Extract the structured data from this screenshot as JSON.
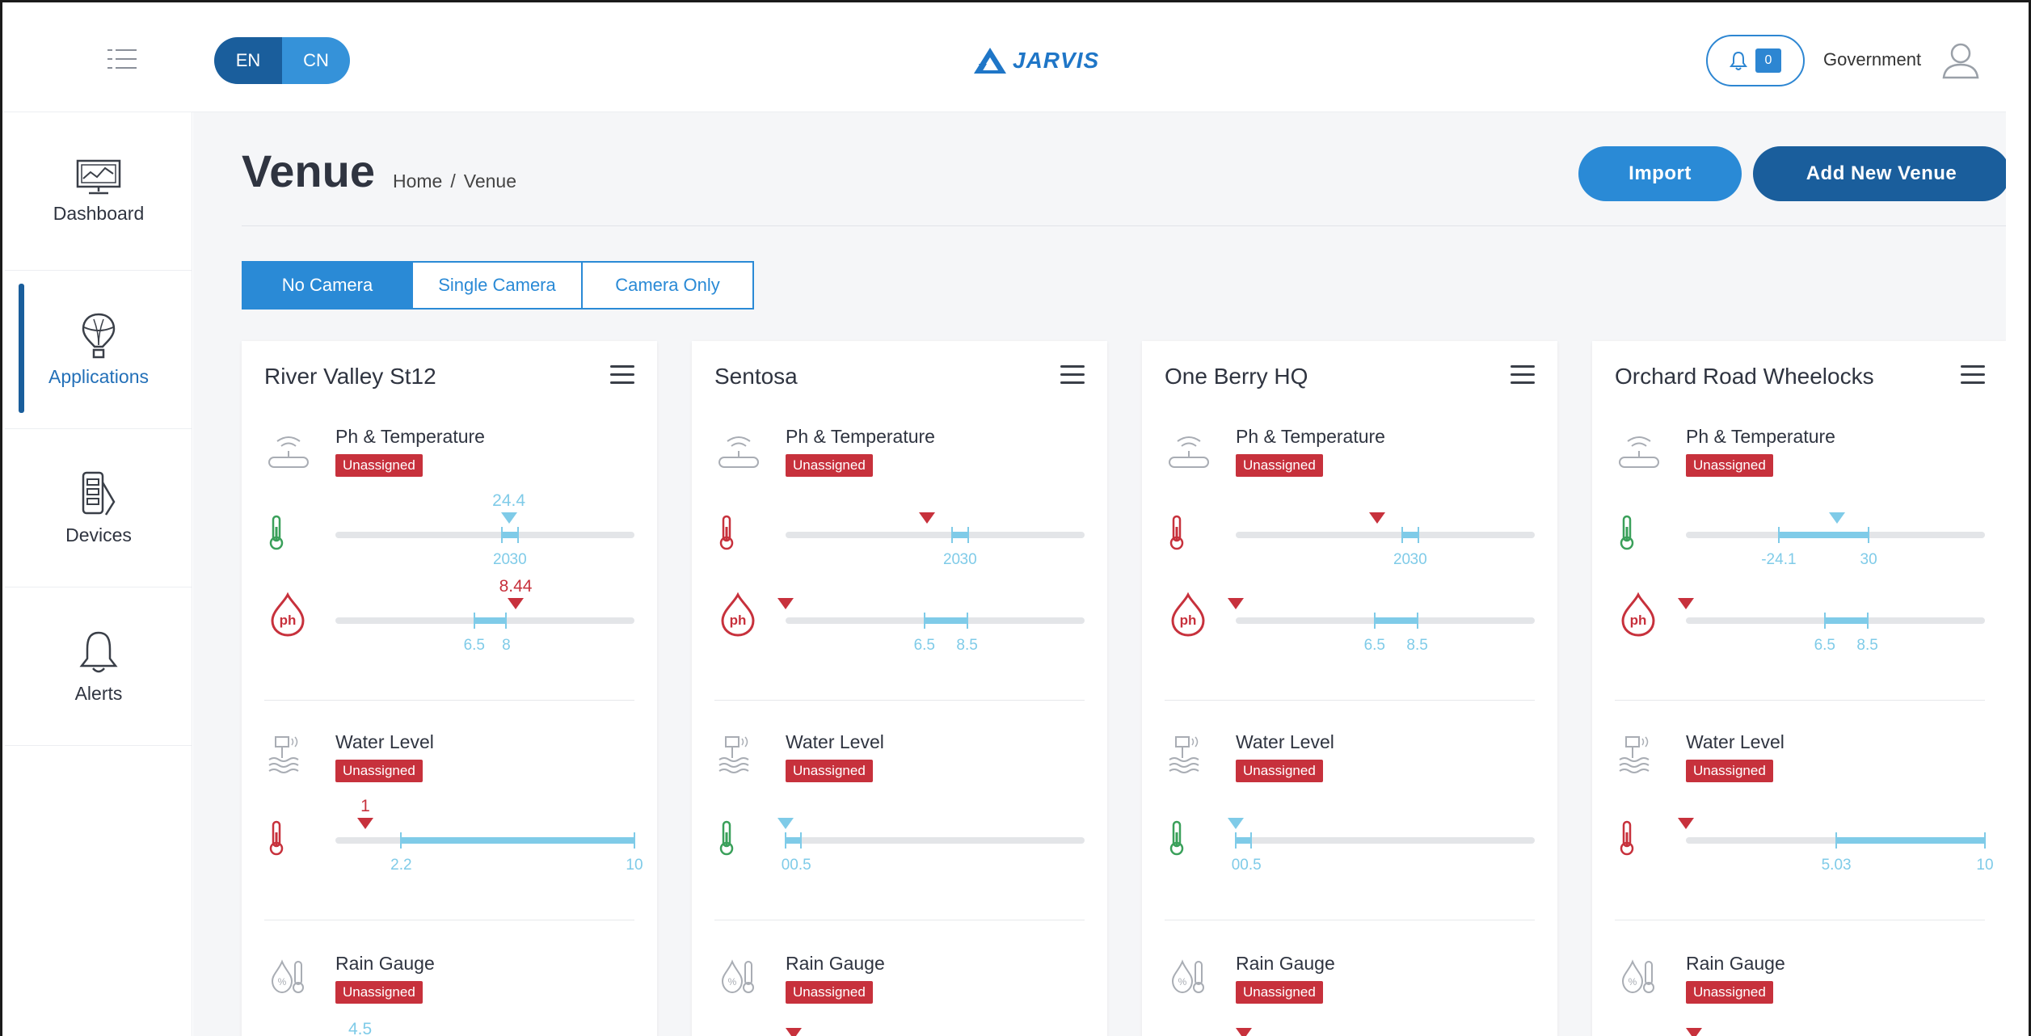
{
  "header": {
    "lang_en": "EN",
    "lang_cn": "CN",
    "logo_text": "JARVIS",
    "notification_count": "0",
    "user_name": "Government"
  },
  "sidebar": {
    "items": [
      {
        "label": "Dashboard",
        "icon": "dashboard-monitor-icon"
      },
      {
        "label": "Applications",
        "icon": "balloon-icon"
      },
      {
        "label": "Devices",
        "icon": "devices-icon"
      },
      {
        "label": "Alerts",
        "icon": "bell-icon"
      }
    ]
  },
  "page": {
    "title": "Venue",
    "breadcrumb": [
      "Home",
      "/",
      "Venue"
    ],
    "import_label": "Import",
    "add_label": "Add New Venue",
    "tabs": [
      "No Camera",
      "Single Camera",
      "Camera Only"
    ]
  },
  "colors": {
    "primary_dark": "#1a5e9c",
    "primary": "#2a8ad6",
    "alert_red": "#c7313c",
    "range_blue": "#7fcbe8"
  },
  "cards": [
    {
      "title": "River Valley St12",
      "ph_temp_name": "Ph & Temperature",
      "ph_temp_badge": "Unassigned",
      "temp": {
        "value": "24.4",
        "min_label": "20",
        "max_label": "30",
        "marker_color": "blue",
        "thermo_color": "green",
        "min": 20,
        "max": 30,
        "reading": 24.4,
        "scale_min": -80,
        "scale_max": 100
      },
      "ph": {
        "value": "8.44",
        "min_label": "6.5",
        "max_label": "8",
        "marker_color": "red",
        "min": 6.5,
        "max": 8,
        "reading": 8.44
      },
      "water_name": "Water Level",
      "water_badge": "Unassigned",
      "water": {
        "value": "1",
        "min_label": "2.2",
        "max_label": "10",
        "marker_color": "red",
        "thermo_color": "red",
        "min": 2.2,
        "max": 10,
        "reading": 1
      },
      "rain_name": "Rain Gauge",
      "rain_badge": "Unassigned",
      "rain_value": "4.5"
    },
    {
      "title": "Sentosa",
      "ph_temp_name": "Ph & Temperature",
      "ph_temp_badge": "Unassigned",
      "temp": {
        "value": "",
        "min_label": "20",
        "max_label": "30",
        "marker_color": "red",
        "thermo_color": "red",
        "min": 20,
        "max": 30,
        "reading": 5,
        "scale_min": -80,
        "scale_max": 100
      },
      "ph": {
        "value": "",
        "min_label": "6.5",
        "max_label": "8.5",
        "marker_color": "red",
        "min": 6.5,
        "max": 8.5,
        "reading": 0
      },
      "water_name": "Water Level",
      "water_badge": "Unassigned",
      "water": {
        "value": "",
        "min_label": "0",
        "max_label": "0.5",
        "marker_color": "blue",
        "thermo_color": "green",
        "min": 0,
        "max": 0.5,
        "reading": 0
      },
      "rain_name": "Rain Gauge",
      "rain_badge": "Unassigned",
      "rain_value": ""
    },
    {
      "title": "One Berry HQ",
      "ph_temp_name": "Ph & Temperature",
      "ph_temp_badge": "Unassigned",
      "temp": {
        "value": "",
        "min_label": "20",
        "max_label": "30",
        "marker_color": "red",
        "thermo_color": "red",
        "min": 20,
        "max": 30,
        "reading": 5,
        "scale_min": -80,
        "scale_max": 100
      },
      "ph": {
        "value": "",
        "min_label": "6.5",
        "max_label": "8.5",
        "marker_color": "red",
        "min": 6.5,
        "max": 8.5,
        "reading": 0
      },
      "water_name": "Water Level",
      "water_badge": "Unassigned",
      "water": {
        "value": "",
        "min_label": "0",
        "max_label": "0.5",
        "marker_color": "blue",
        "thermo_color": "green",
        "min": 0,
        "max": 0.5,
        "reading": 0
      },
      "rain_name": "Rain Gauge",
      "rain_badge": "Unassigned",
      "rain_value": ""
    },
    {
      "title": "Orchard Road Wheelocks",
      "ph_temp_name": "Ph & Temperature",
      "ph_temp_badge": "Unassigned",
      "temp": {
        "value": "",
        "min_label": "-24.1",
        "max_label": "30",
        "marker_color": "blue",
        "thermo_color": "green",
        "min": -24.1,
        "max": 30,
        "reading": 11,
        "scale_min": -80,
        "scale_max": 100
      },
      "ph": {
        "value": "",
        "min_label": "6.5",
        "max_label": "8.5",
        "marker_color": "red",
        "min": 6.5,
        "max": 8.5,
        "reading": 0
      },
      "water_name": "Water Level",
      "water_badge": "Unassigned",
      "water": {
        "value": "",
        "min_label": "5.03",
        "max_label": "10",
        "marker_color": "red",
        "thermo_color": "red",
        "min": 5.03,
        "max": 10,
        "reading": 0
      },
      "rain_name": "Rain Gauge",
      "rain_badge": "Unassigned",
      "rain_value": ""
    }
  ]
}
